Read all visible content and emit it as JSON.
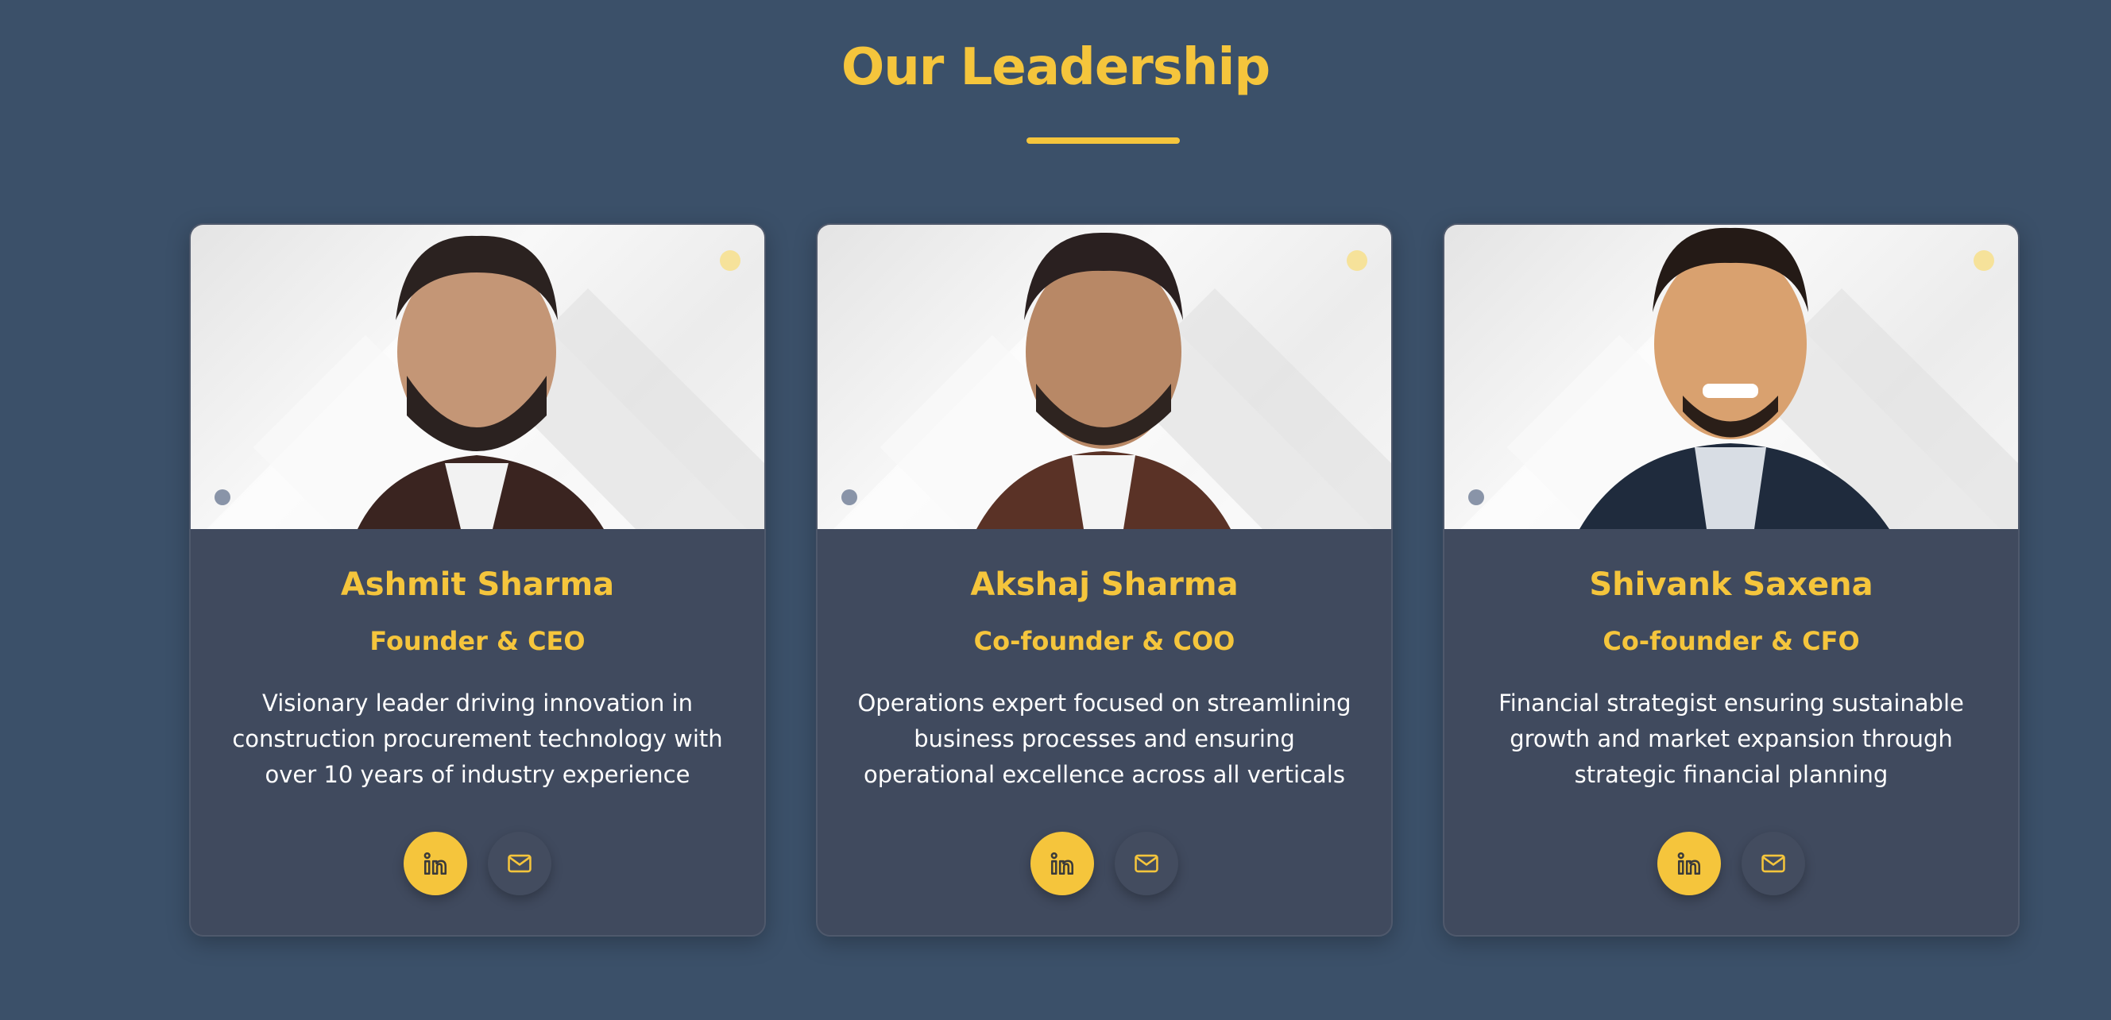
{
  "section": {
    "title": "Our Leadership"
  },
  "colors": {
    "background": "#3b5069",
    "accent": "#f5c53c",
    "card": "#404a5e",
    "text": "#ffffff"
  },
  "leaders": [
    {
      "name": "Ashmit Sharma",
      "role": "Founder & CEO",
      "description": "Visionary leader driving innovation in construction procurement technology with over 10 years of industry experience",
      "icons": [
        "linkedin-icon",
        "mail-icon"
      ]
    },
    {
      "name": "Akshaj Sharma",
      "role": "Co-founder & COO",
      "description": "Operations expert focused on streamlining business processes and ensuring operational excellence across all verticals",
      "icons": [
        "linkedin-icon",
        "mail-icon"
      ]
    },
    {
      "name": "Shivank Saxena",
      "role": "Co-founder & CFO",
      "description": "Financial strategist ensuring sustainable growth and market expansion through strategic financial planning",
      "icons": [
        "linkedin-icon",
        "mail-icon"
      ]
    }
  ]
}
